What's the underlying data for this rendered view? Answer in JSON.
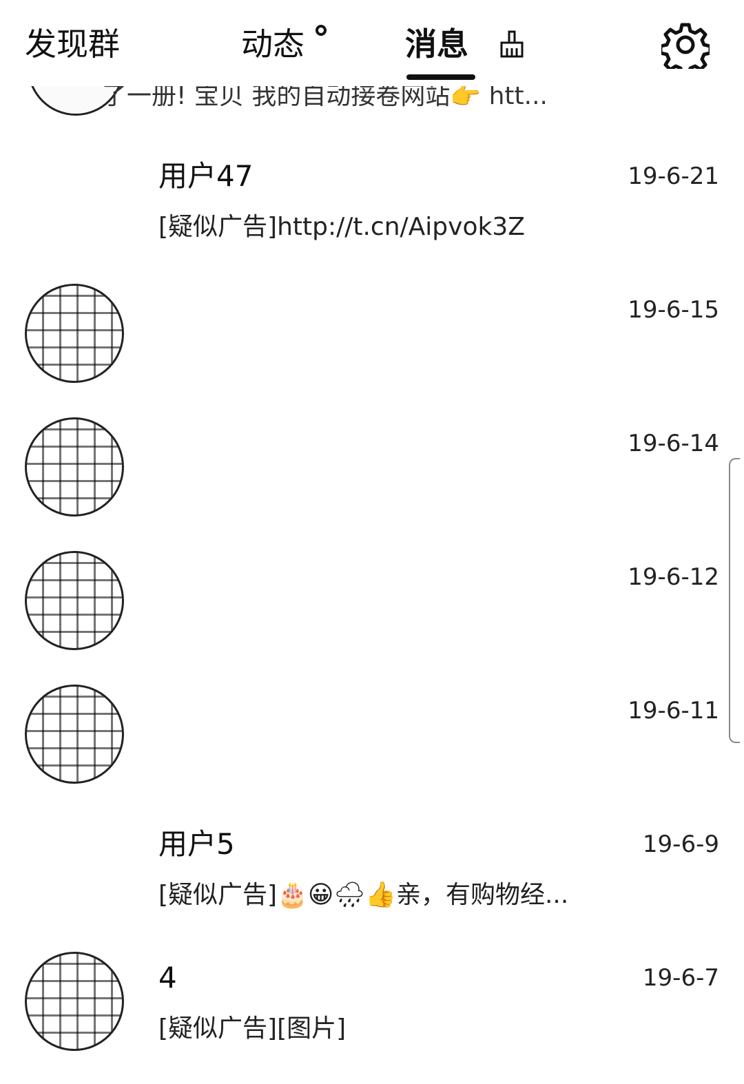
{
  "topbar": {
    "tabs": [
      {
        "label": "发现群"
      },
      {
        "label": "动态"
      },
      {
        "label": "消息"
      }
    ],
    "active_tab": "消息",
    "icons": {
      "new_indicator": "dot-indicator",
      "clear": "broom-icon",
      "settings": "gear-icon"
    }
  },
  "partial_item": {
    "preview": "了一册! 宝贝 我的自动接卷网站👉 htt..."
  },
  "conversations": [
    {
      "name": "用户47",
      "date": "19-6-21",
      "preview": "[疑似广告]http://t.cn/Aipvok3Z"
    },
    {
      "name": "",
      "date": "19-6-15",
      "preview": ""
    },
    {
      "name": "",
      "date": "19-6-14",
      "preview": ""
    },
    {
      "name": "",
      "date": "19-6-12",
      "preview": ""
    },
    {
      "name": "",
      "date": "19-6-11",
      "preview": ""
    },
    {
      "name": "用户5",
      "date": "19-6-9",
      "preview": "[疑似广告]🎂😀🌧👍亲，有购物经..."
    },
    {
      "name": "4",
      "date": "19-6-7",
      "preview": "[疑似广告][图片]"
    }
  ],
  "colors": {
    "text": "#111111",
    "background": "#ffffff",
    "accent": "#111111"
  }
}
